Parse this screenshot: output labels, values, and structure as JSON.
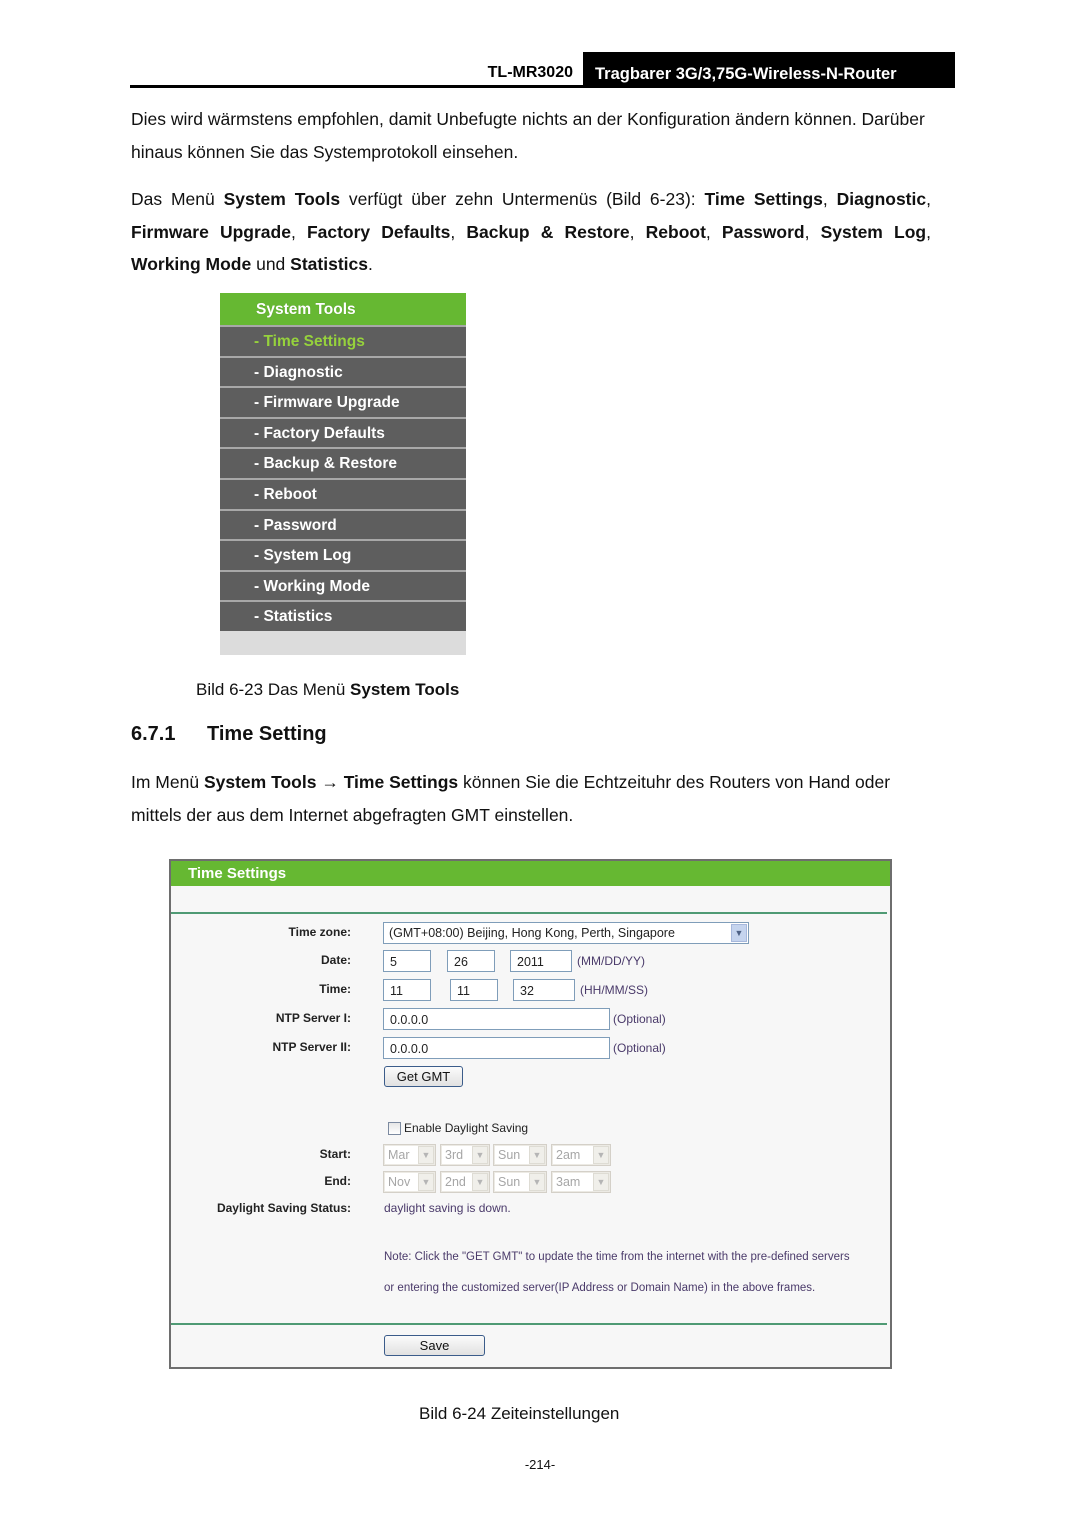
{
  "header": {
    "model": "TL-MR3020",
    "title": "Tragbarer 3G/3,75G-Wireless-N-Router"
  },
  "intro": {
    "line": "Dies wird wärmstens empfohlen, damit Unbefugte nichts an der Konfiguration ändern können. Darüber hinaus können Sie das Systemprotokoll einsehen."
  },
  "menu_paragraph": {
    "t1": "Das Menü ",
    "b1": "System Tools",
    "t2": " verfügt über zehn Untermenüs (Bild 6-23): ",
    "b_items": [
      "Time Settings",
      "Diagnostic",
      "Firmware Upgrade",
      "Factory Defaults",
      "Backup & Restore",
      "Reboot",
      "Password",
      "System Log",
      "Working Mode",
      "Statistics"
    ],
    "sep": ", ",
    "und": " und ",
    "end": "."
  },
  "menu_image": {
    "heading": "System Tools",
    "items": [
      {
        "label": "- Time Settings",
        "active": true
      },
      {
        "label": "- Diagnostic",
        "active": false
      },
      {
        "label": "- Firmware Upgrade",
        "active": false
      },
      {
        "label": "- Factory Defaults",
        "active": false
      },
      {
        "label": "- Backup & Restore",
        "active": false
      },
      {
        "label": "- Reboot",
        "active": false
      },
      {
        "label": "- Password",
        "active": false
      },
      {
        "label": "- System Log",
        "active": false
      },
      {
        "label": "- Working Mode",
        "active": false
      },
      {
        "label": "- Statistics",
        "active": false
      }
    ],
    "colors": {
      "header_green": "#66b832",
      "item_bg": "#5e5e5e",
      "active_text": "#96d23c"
    }
  },
  "caption1": {
    "prefix": "Bild 6-23 Das Menü ",
    "bold": "System Tools"
  },
  "section": {
    "number": "6.7.1",
    "title": "Time Setting"
  },
  "section_para": {
    "t1": "Im Menü ",
    "b1": "System Tools",
    "arrow": " → ",
    "b2": "Time Settings",
    "t2": " können Sie die Echtzeituhr des Routers von Hand oder mittels der aus dem Internet abgefragten GMT einstellen."
  },
  "time_settings": {
    "heading": "Time Settings",
    "timezone": {
      "label": "Time zone:",
      "value": "(GMT+08:00) Beijing, Hong Kong, Perth, Singapore"
    },
    "date": {
      "label": "Date:",
      "month": "5",
      "day": "26",
      "year": "2011",
      "hint": "(MM/DD/YY)"
    },
    "time": {
      "label": "Time:",
      "hour": "11",
      "minute": "11",
      "second": "32",
      "hint": "(HH/MM/SS)"
    },
    "ntp1": {
      "label": "NTP Server I:",
      "value": "0.0.0.0",
      "hint": "(Optional)"
    },
    "ntp2": {
      "label": "NTP Server II:",
      "value": "0.0.0.0",
      "hint": "(Optional)"
    },
    "get_gmt": "Get GMT",
    "dst_checkbox": {
      "label": "Enable Daylight Saving",
      "checked": false
    },
    "start": {
      "label": "Start:",
      "month": "Mar",
      "week": "3rd",
      "day": "Sun",
      "hour": "2am"
    },
    "end": {
      "label": "End:",
      "month": "Nov",
      "week": "2nd",
      "day": "Sun",
      "hour": "3am"
    },
    "dst_status": {
      "label": "Daylight Saving Status:",
      "value": "daylight saving is down."
    },
    "note_line1": "Note: Click the \"GET GMT\" to update the time from the internet with the pre-defined servers",
    "note_line2": "or entering the customized server(IP Address or Domain Name) in the above frames.",
    "save": "Save"
  },
  "caption2": "Bild 6-24 Zeiteinstellungen",
  "page_number": "-214-"
}
